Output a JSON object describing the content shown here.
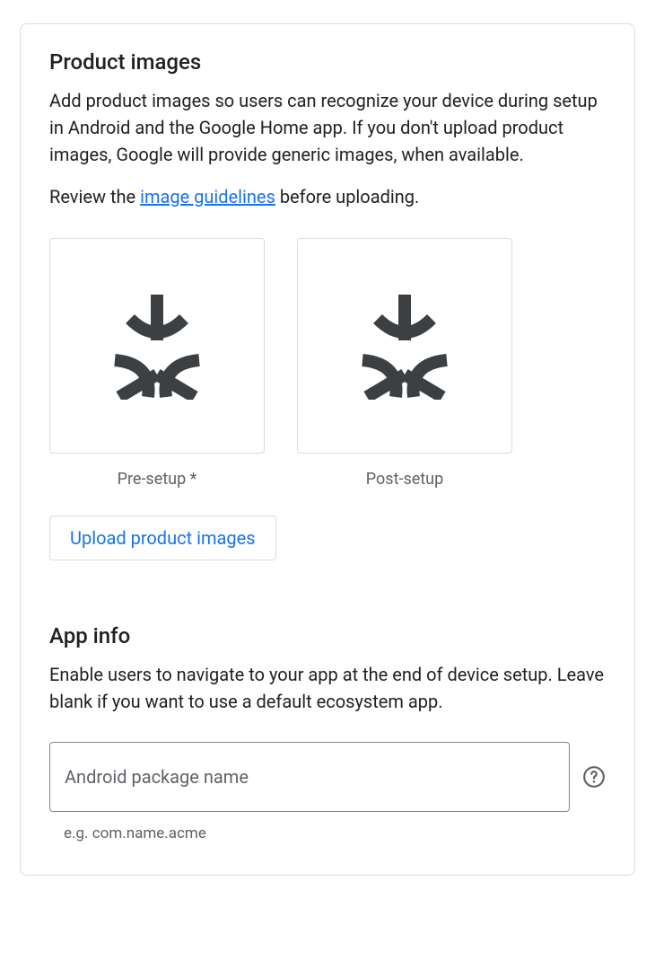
{
  "productImages": {
    "title": "Product images",
    "description": "Add product images so users can recognize your device during setup in Android and the Google Home app. If you don't upload product images, Google will provide generic images, when available.",
    "reviewPrefix": "Review the ",
    "reviewLinkText": "image guidelines",
    "reviewSuffix": " before uploading.",
    "tiles": [
      {
        "caption": "Pre-setup *"
      },
      {
        "caption": "Post-setup"
      }
    ],
    "uploadButton": "Upload product images"
  },
  "appInfo": {
    "title": "App info",
    "description": "Enable users to navigate to your app at the end of device setup. Leave blank if you want to use a default ecosystem app.",
    "packageField": {
      "placeholder": "Android package name",
      "value": "",
      "helper": "e.g. com.name.acme"
    }
  }
}
